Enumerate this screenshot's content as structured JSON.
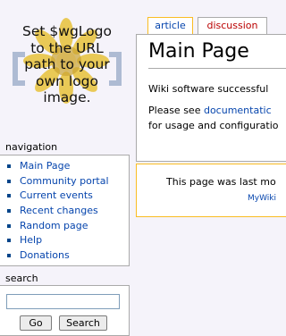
{
  "logo": {
    "lines": [
      "Set $wgLogo",
      "to the URL",
      "path to your",
      "own logo",
      "image."
    ]
  },
  "navigation": {
    "title": "navigation",
    "items": [
      {
        "label": "Main Page"
      },
      {
        "label": "Community portal"
      },
      {
        "label": "Current events"
      },
      {
        "label": "Recent changes"
      },
      {
        "label": "Random page"
      },
      {
        "label": "Help"
      },
      {
        "label": "Donations"
      }
    ]
  },
  "search": {
    "title": "search",
    "value": "",
    "go_label": "Go",
    "search_label": "Search"
  },
  "tabs": [
    {
      "label": "article",
      "selected": true
    },
    {
      "label": "discussion",
      "selected": false
    }
  ],
  "content": {
    "title": "Main Page",
    "line1": "Wiki software successful",
    "line2_prefix": "Please see ",
    "line2_link": "documentatic",
    "line3": "for usage and configuratio"
  },
  "footer": {
    "line1": "This page was last mo",
    "line2": "MyWiki"
  },
  "colors": {
    "link": "#0645ad",
    "selected_tab_border": "#fabd23",
    "new_tab": "#ba0000",
    "background": "#f5f3fa"
  }
}
